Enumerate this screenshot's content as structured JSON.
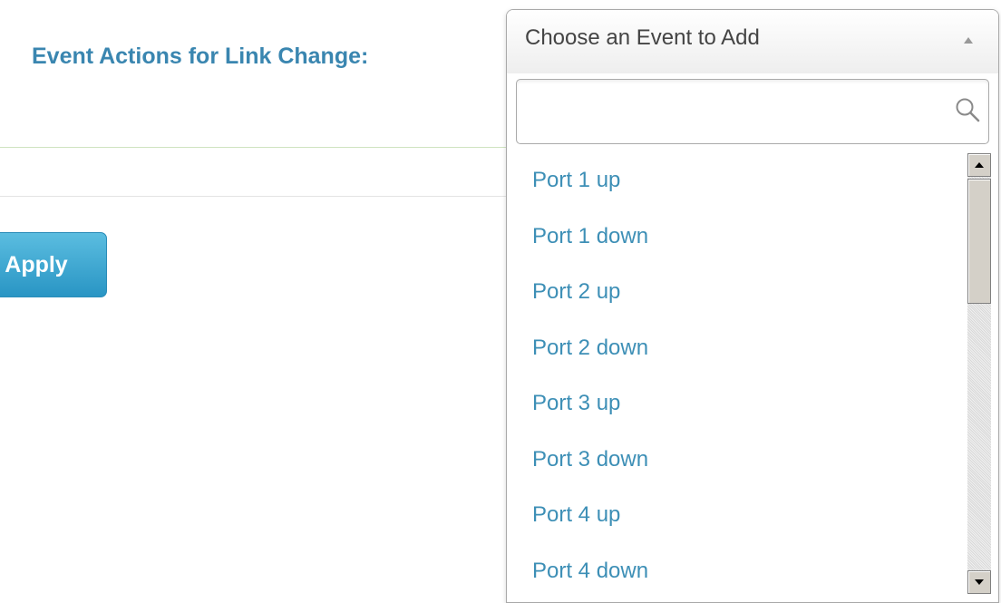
{
  "form": {
    "label": "Event Actions for Link Change:",
    "apply_label": "Apply"
  },
  "dropdown": {
    "selected_label": "Choose an Event to Add",
    "toggle_icon": "arrow-up-icon",
    "search": {
      "value": "",
      "placeholder": "",
      "icon": "search-icon"
    },
    "options": [
      "Port 1 up",
      "Port 1 down",
      "Port 2 up",
      "Port 2 down",
      "Port 3 up",
      "Port 3 down",
      "Port 4 up",
      "Port 4 down"
    ]
  },
  "colors": {
    "label_text": "#3a86b0",
    "option_text": "#3d8fb6",
    "apply_button": "#2995c4",
    "divider_green": "#cfe3c0"
  }
}
